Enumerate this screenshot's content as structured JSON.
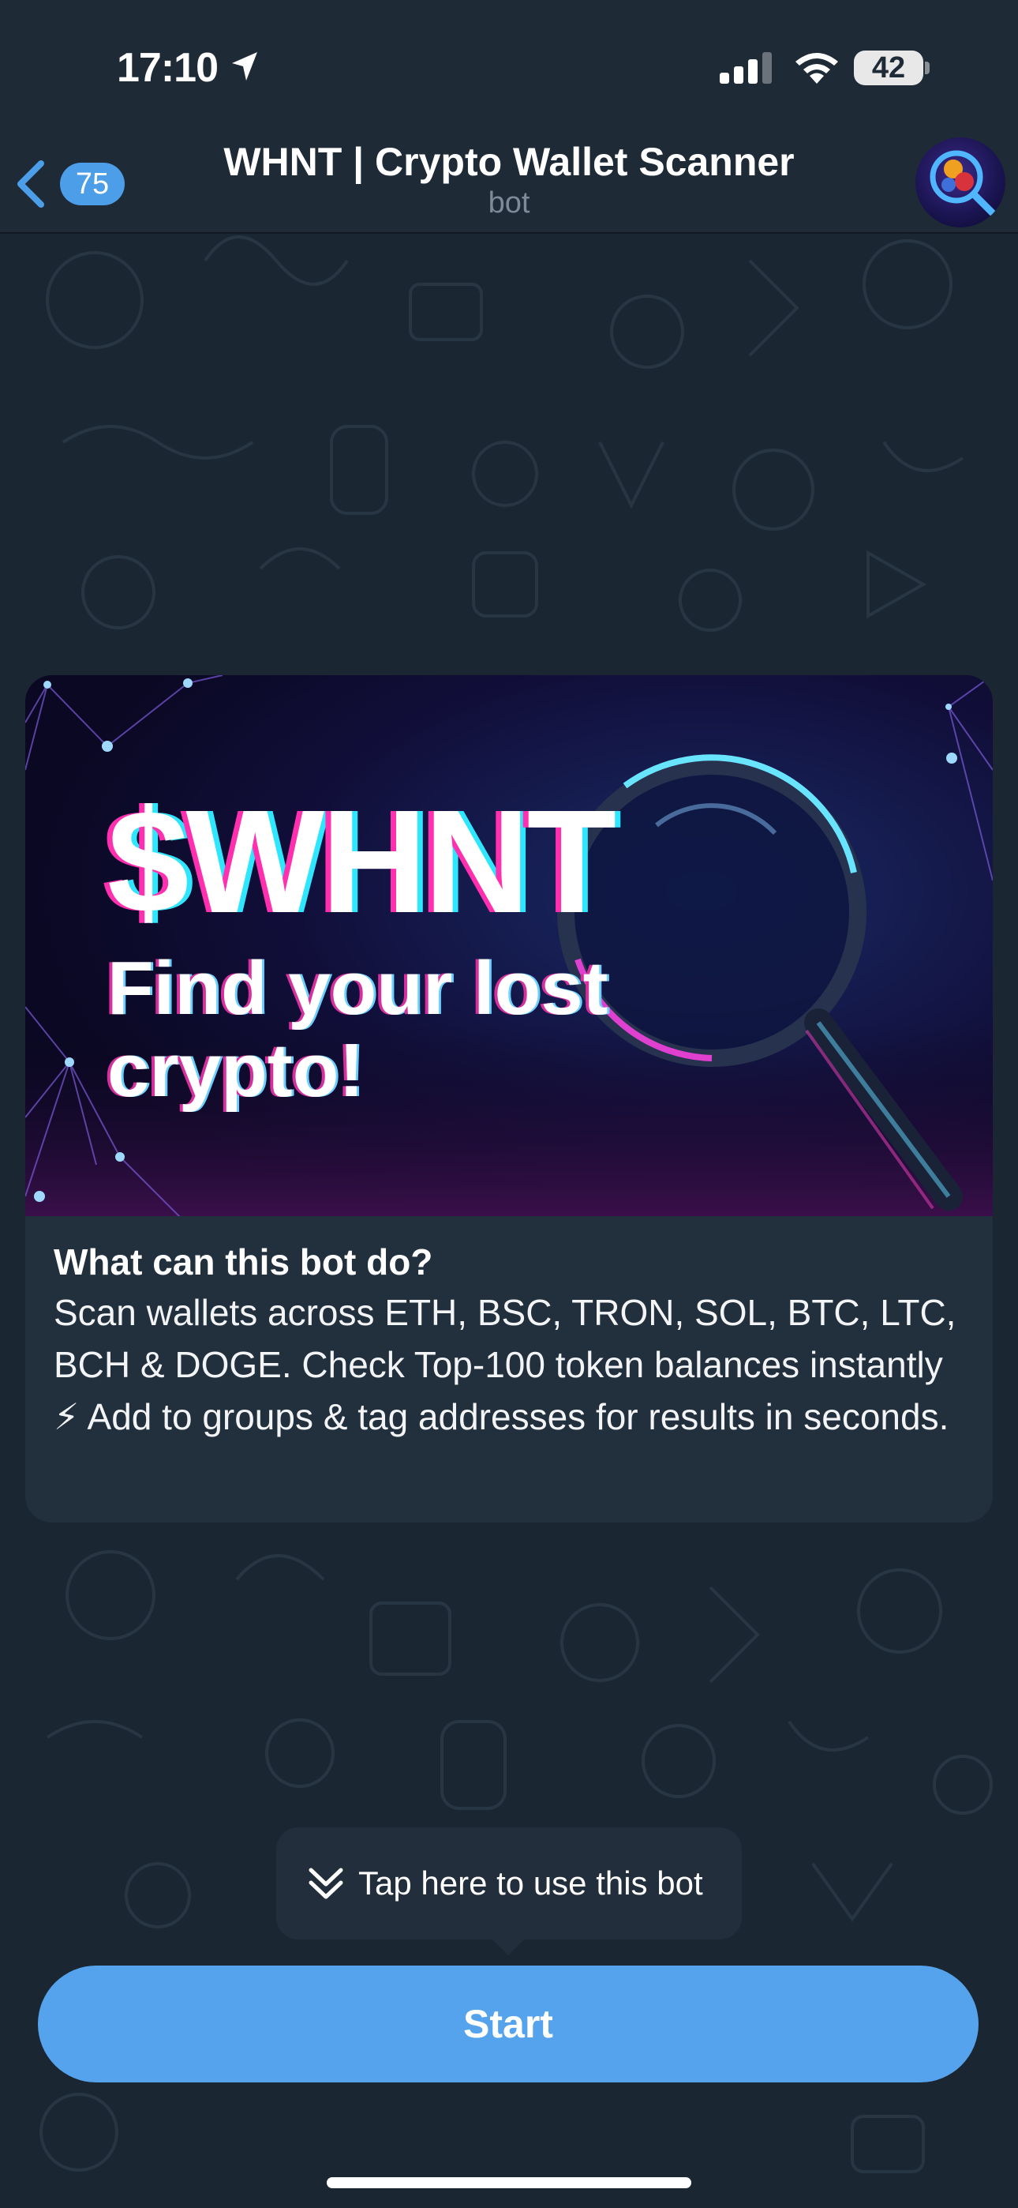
{
  "status_bar": {
    "time": "17:10",
    "battery": "42",
    "icons": [
      "location-arrow-icon",
      "cellular-signal-icon",
      "wifi-icon",
      "battery-icon"
    ]
  },
  "header": {
    "back_icon": "chevron-left-icon",
    "unread_count": "75",
    "title": "WHNT | Crypto Wallet Scanner",
    "subtitle": "bot",
    "avatar_icon": "magnifier-coin-avatar"
  },
  "message": {
    "banner": {
      "title": "$WHNT",
      "subtitle": "Find your lost crypto!"
    },
    "heading": "What can this bot do?",
    "text": "Scan wallets across ETH, BSC, TRON, SOL, BTC, LTC, BCH & DOGE. Check Top-100 token balances instantly ⚡ Add to groups & tag addresses for results in seconds."
  },
  "tooltip": {
    "icon": "double-chevron-down-icon",
    "text": "Tap here to use this bot"
  },
  "start_button": {
    "label": "Start"
  },
  "colors": {
    "accent": "#54a3ec",
    "badge": "#4c9ee8",
    "background": "#1b2633",
    "header": "#1f2a37"
  }
}
